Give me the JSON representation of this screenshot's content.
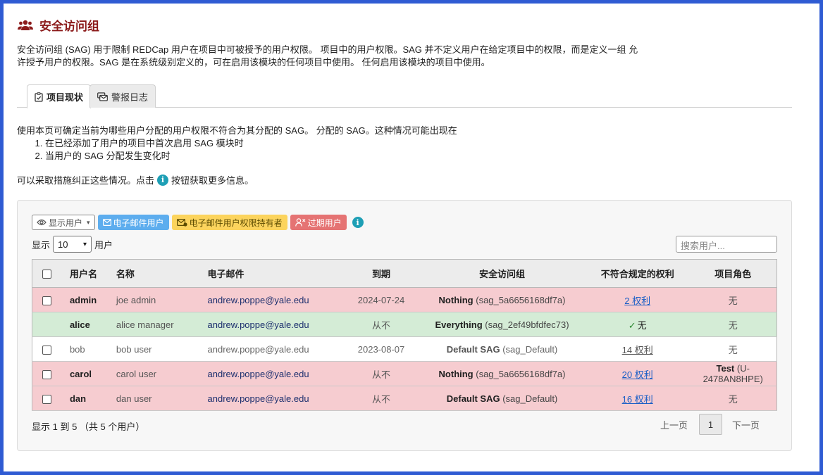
{
  "header": {
    "title": "安全访问组",
    "icon": "users-icon",
    "title_color": "#8b1a1a"
  },
  "intro": {
    "line1": "安全访问组 (SAG) 用于限制 REDCap 用户在项目中可被授予的用户权限。 项目中的用户权限。SAG 并不定义用户在给定项目中的权限，而是定义一组 允",
    "line2": "许授予用户的权限。SAG 是在系统级别定义的，可在启用该模块的任何项目中使用。 任何启用该模块的项目中使用。"
  },
  "tabs": [
    {
      "label": "项目现状",
      "icon": "clipboard-check-icon",
      "active": true
    },
    {
      "label": "警报日志",
      "icon": "envelopes-icon",
      "active": false
    }
  ],
  "description": {
    "lead": "使用本页可确定当前为哪些用户分配的用户权限不符合为其分配的 SAG。 分配的 SAG。这种情况可能出现在",
    "items": [
      "在已经添加了用户的项目中首次启用 SAG 模块时",
      "当用户的 SAG 分配发生变化时"
    ],
    "note_before": "可以采取措施纠正这些情况。点击",
    "note_after": "按钮获取更多信息。"
  },
  "toolbar": {
    "show_users": "显示用户",
    "email_users": "电子邮件用户",
    "email_rights_holders": "电子邮件用户权限持有者",
    "expire_users": "过期用户",
    "colors": {
      "email": "#5dadee",
      "holder": "#fcd45d",
      "expire": "#e57373"
    }
  },
  "length": {
    "prefix": "显示",
    "value": "10",
    "suffix": "用户"
  },
  "search": {
    "placeholder": "搜索用户..."
  },
  "table": {
    "headers": [
      "用户名",
      "名称",
      "电子邮件",
      "到期",
      "安全访问组",
      "不符合规定的权利",
      "项目角色"
    ],
    "rows": [
      {
        "status": "bad",
        "checkbox": true,
        "username": "admin",
        "name": "joe admin",
        "email": "andrew.poppe@yale.edu",
        "expiration": "2024-07-24",
        "sag_name": "Nothing",
        "sag_id": "(sag_5a6656168df7a)",
        "rights": "2 权利",
        "role_name": "",
        "role_id": "无"
      },
      {
        "status": "good",
        "checkbox": false,
        "username": "alice",
        "name": "alice manager",
        "email": "andrew.poppe@yale.edu",
        "expiration": "从不",
        "sag_name": "Everything",
        "sag_id": "(sag_2ef49bfdfec73)",
        "rights": "无",
        "role_name": "",
        "role_id": "无"
      },
      {
        "status": "plain",
        "checkbox": true,
        "username": "bob",
        "name": "bob user",
        "email": "andrew.poppe@yale.edu",
        "expiration": "2023-08-07",
        "sag_name": "Default SAG",
        "sag_id": "(sag_Default)",
        "rights": "14 权利",
        "role_name": "",
        "role_id": "无"
      },
      {
        "status": "bad",
        "checkbox": true,
        "username": "carol",
        "name": "carol user",
        "email": "andrew.poppe@yale.edu",
        "expiration": "从不",
        "sag_name": "Nothing",
        "sag_id": "(sag_5a6656168df7a)",
        "rights": "20 权利",
        "role_name": "Test",
        "role_id": "(U-2478AN8HPE)"
      },
      {
        "status": "bad",
        "checkbox": true,
        "username": "dan",
        "name": "dan user",
        "email": "andrew.poppe@yale.edu",
        "expiration": "从不",
        "sag_name": "Default SAG",
        "sag_id": "(sag_Default)",
        "rights": "16 权利",
        "role_name": "",
        "role_id": "无"
      }
    ]
  },
  "footer": {
    "info": "显示 1 到 5 （共 5 个用户）",
    "prev": "上一页",
    "page": "1",
    "next": "下一页"
  }
}
